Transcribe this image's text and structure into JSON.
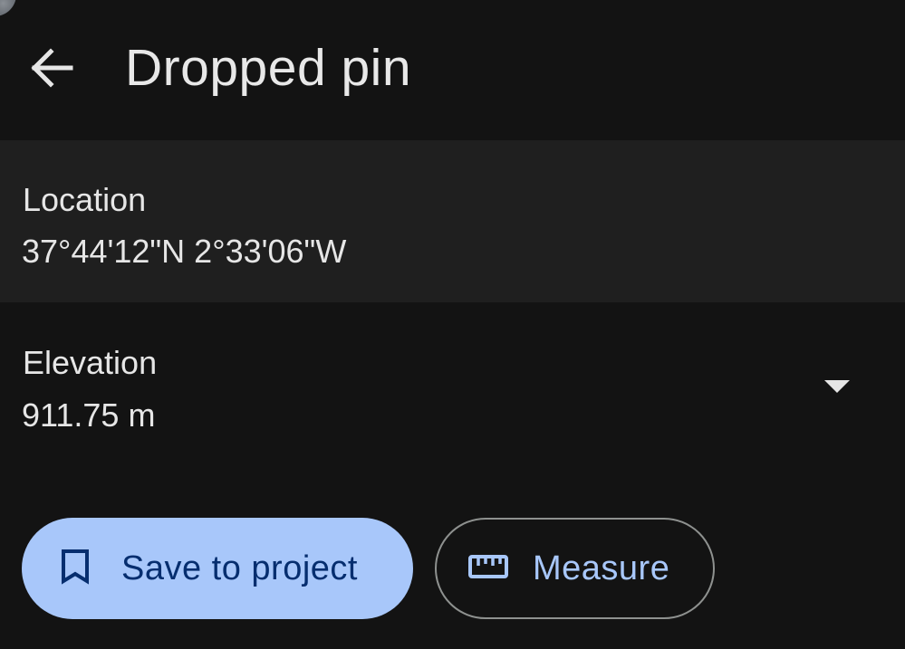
{
  "header": {
    "title": "Dropped pin",
    "back_icon": "arrow-back-icon"
  },
  "location": {
    "label": "Location",
    "value": "37°44'12\"N 2°33'06\"W"
  },
  "elevation": {
    "label": "Elevation",
    "value": "911.75 m",
    "expand_icon": "arrow-drop-down-icon"
  },
  "actions": {
    "save_label": "Save to project",
    "save_icon": "bookmark-icon",
    "measure_label": "Measure",
    "measure_icon": "ruler-icon"
  },
  "colors": {
    "background": "#131313",
    "card": "#1f1f1f",
    "accent": "#a8c7fa",
    "on_accent": "#062e6f",
    "outline": "#8e918f"
  }
}
